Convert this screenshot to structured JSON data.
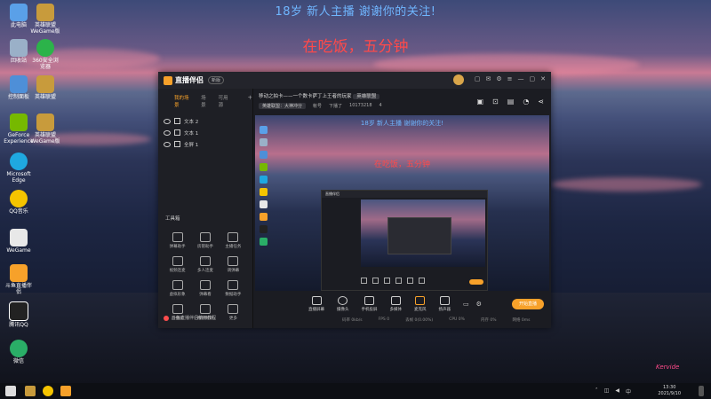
{
  "banner": {
    "top": "18岁 新人主播 谢谢你的关注!",
    "status": "在吃饭，五分钟"
  },
  "desktop_icons": [
    {
      "label": "此电脑",
      "icon": "computer-icon",
      "color": "#5aa0e8"
    },
    {
      "label": "回收站",
      "icon": "recycle-bin-icon",
      "color": "#9ab0c8"
    },
    {
      "label": "控制面板",
      "icon": "control-panel-icon",
      "color": "#4e8fd8"
    },
    {
      "label": "GeForce Experience",
      "icon": "geforce-icon",
      "color": "#76b900"
    },
    {
      "label": "Microsoft Edge",
      "icon": "edge-icon",
      "color": "#1fa8e0"
    },
    {
      "label": "QQ音乐",
      "icon": "qq-music-icon",
      "color": "#f5c400"
    },
    {
      "label": "WeGame",
      "icon": "wegame-icon",
      "color": "#e8e8e8"
    },
    {
      "label": "斗鱼直播伴侣",
      "icon": "douyu-icon",
      "color": "#f7a12a"
    },
    {
      "label": "腾讯QQ",
      "icon": "qq-icon",
      "color": "#222222"
    },
    {
      "label": "微信",
      "icon": "wechat-icon",
      "color": "#2aae67"
    }
  ],
  "desktop_icons_col2": [
    {
      "label": "英雄联盟 WeGame版",
      "icon": "lol-icon",
      "color": "#c89b3c"
    },
    {
      "label": "360安全浏览器",
      "icon": "browser-360-icon",
      "color": "#2cb34a"
    },
    {
      "label": "英雄联盟",
      "icon": "lol-icon",
      "color": "#c89b3c"
    },
    {
      "label": "英雄联盟 WeGame版",
      "icon": "lol-icon",
      "color": "#c89b3c"
    }
  ],
  "app": {
    "name": "直播伴侣",
    "version": "新版",
    "sidebar_tabs": [
      "我的场景",
      "场景",
      "可用源"
    ],
    "sources": [
      "文本 2",
      "文本 1",
      "全屏 1"
    ],
    "tools_header": "工具箱",
    "tools": [
      "弹幕助手",
      "房管助手",
      "主播任务",
      "视频连麦",
      "多人连麦",
      "调弹幕",
      "虚拟形象",
      "弹幕看",
      "数据助手",
      "直播间",
      "精彩时刻",
      "更多"
    ],
    "footer": "斗鱼直播伴侣使用教程",
    "room_title": "移动之拍卡——一个数卡萨丁上王者的玩家",
    "room_tag": "英雄联盟",
    "room_sub": [
      "英雄联盟：大神冲分",
      "帐号",
      "下播了",
      "10173218",
      "4"
    ],
    "controls": [
      "直播屏幕",
      "摄像头",
      "手机投屏",
      "多媒体",
      "麦克风",
      "扬声器"
    ],
    "go_live": "开始直播",
    "status_bar": [
      "码率 0kb/s",
      "FPS 0",
      "丢帧 0(0.00%)",
      "CPU 0%",
      "内存 0%",
      "网络 0ms"
    ]
  },
  "preview": {
    "top": "18岁 新人主播 谢谢你的关注!",
    "status": "在吃饭，五分钟"
  },
  "taskbar": {
    "time": "13:30",
    "date": "2021/9/10",
    "lang": "中"
  },
  "signature": "Kervide"
}
